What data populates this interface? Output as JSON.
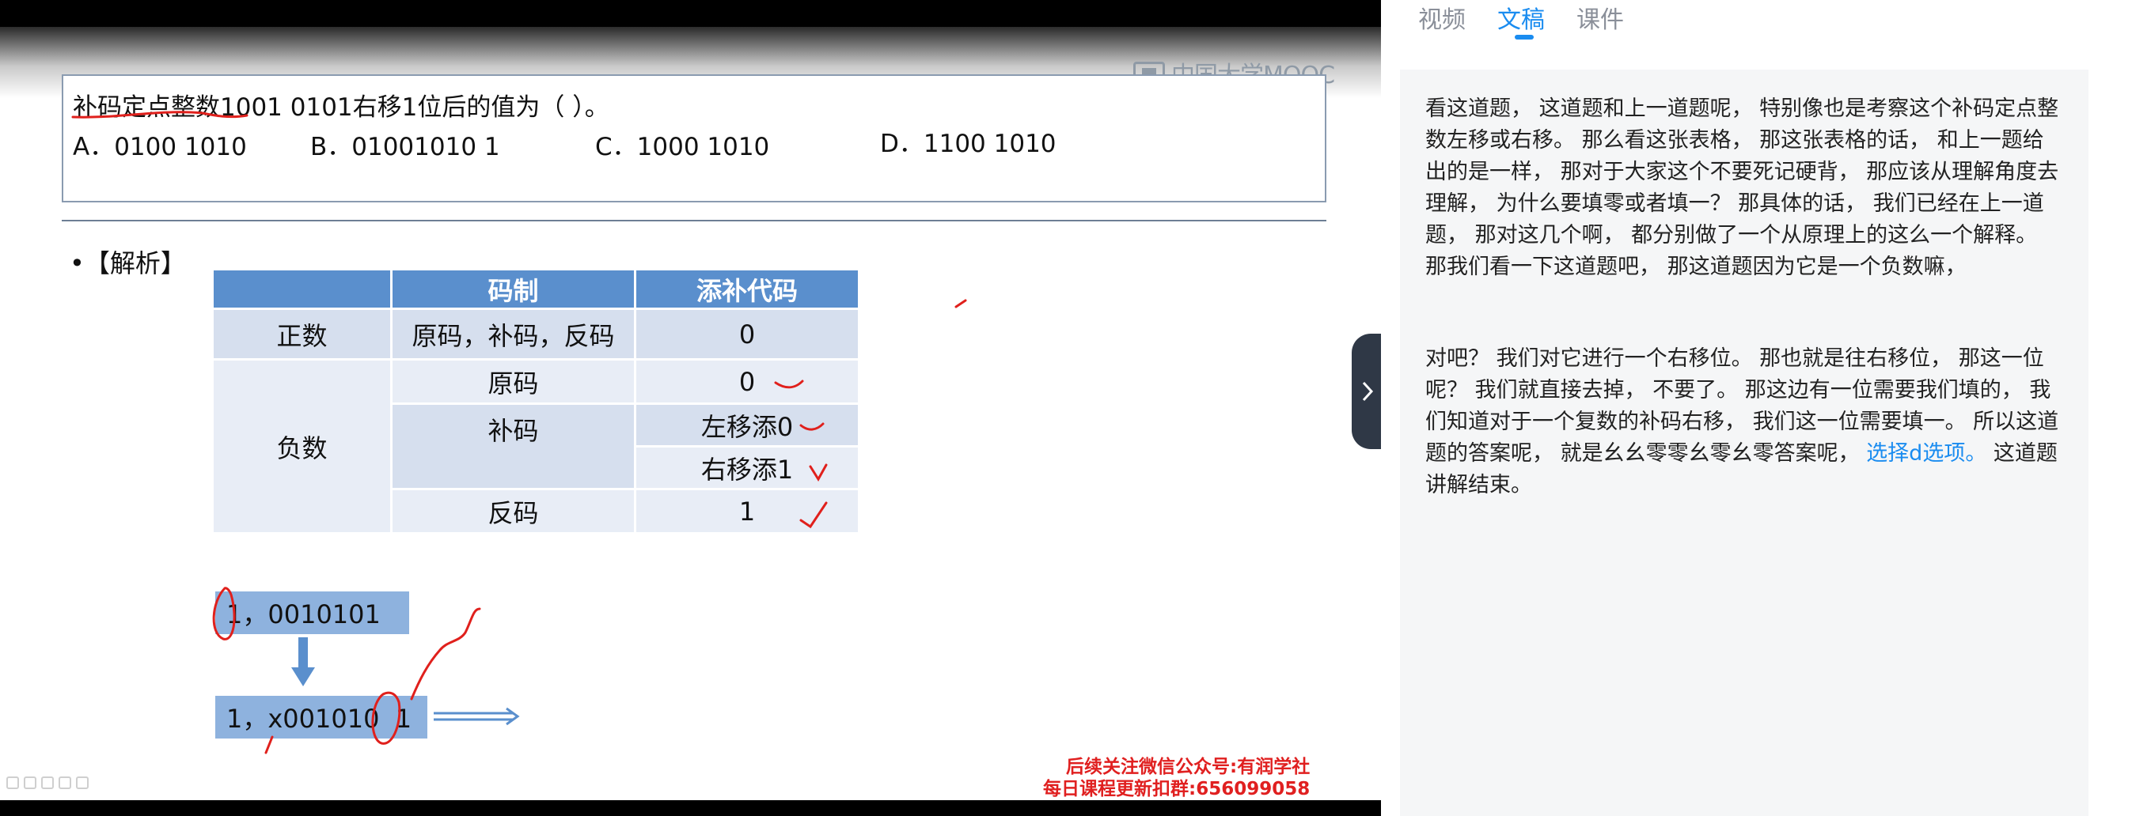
{
  "video": {
    "logo_text": "中国大学MOOC",
    "question": {
      "title": "补码定点整数1001 0101右移1位后的值为（   ）。",
      "options": [
        "A．0100 1010",
        "B．01001010 1",
        "C．1000 1010",
        "D．1100 1010"
      ]
    },
    "analysis_label": "•【解析】",
    "table": {
      "headers": [
        "",
        "码制",
        "添补代码"
      ],
      "zheng_label": "正数",
      "zheng_codes": "原码，补码，反码",
      "zheng_value": "0",
      "fu_label": "负数",
      "yuan_label": "原码",
      "yuan_value": "0",
      "bu_label": "补码",
      "bu_left": "左移添0",
      "bu_right": "右移添1",
      "fan_label": "反码",
      "fan_value": "1"
    },
    "binary_before": "1，0010101",
    "binary_after": "1，x001010  1",
    "promo_line1": "后续关注微信公众号:有润学社",
    "promo_line2": "每日课程更新扣群:656099058"
  },
  "side": {
    "tabs": [
      "视频",
      "文稿",
      "课件"
    ],
    "active_tab": "文稿",
    "transcript_p1": "看这道题， 这道题和上一道题呢， 特别像也是考察这个补码定点整数左移或右移。 那么看这张表格， 那这张表格的话， 和上一题给出的是一样， 那对于大家这个不要死记硬背， 那应该从理解角度去理解， 为什么要填零或者填一？ 那具体的话， 我们已经在上一道题， 那对这几个啊， 都分别做了一个从原理上的这么一个解释。 那我们看一下这道题吧， 那这道题因为它是一个负数嘛，",
    "transcript_p2_start": "对吧？ 我们对它进行一个右移位。 那也就是往右移位， 那这一位呢？ 我们就直接去掉， 不要了。 那这边有一位需要我们填的， 我们知道对于一个复数的补码右移， 我们这一位需要填一。 所以这道题的答案呢， 就是幺幺零零幺零幺零答案呢，",
    "transcript_p2_link": "选择d选项。",
    "transcript_p2_end": "这道题讲解结束。"
  },
  "colors": {
    "accent": "#1a8cf0",
    "table_header": "#5a8fcd",
    "table_cell": "#d6dfee",
    "binary_box": "#8eb2de",
    "ink_red": "#e0201c"
  }
}
